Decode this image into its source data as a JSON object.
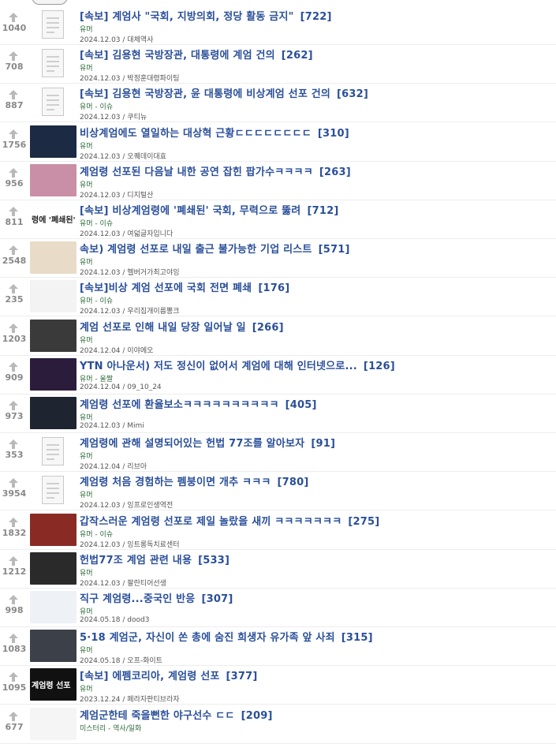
{
  "posts": [
    {
      "votes": "1040",
      "title": "[속보] 계엄사 \"국회, 지방의회, 정당 활동 금지\"",
      "comments": "[722]",
      "category": "유머",
      "meta": "2024.12.03 / 대체역사",
      "thumb": "doc",
      "thumb_color": "#ffffff"
    },
    {
      "votes": "708",
      "title": "[속보] 김용현 국방장관, 대통령에 계엄 건의",
      "comments": "[262]",
      "category": "유머",
      "meta": "2024.12.03 / 박정훈대령파이팅",
      "thumb": "doc",
      "thumb_color": "#ffffff"
    },
    {
      "votes": "887",
      "title": "[속보] 김용현 국방장관, 윤 대통령에 비상계엄 선포 건의",
      "comments": "[632]",
      "category": "유머 - 이슈",
      "meta": "2024.12.03 / 쿠티뉴",
      "thumb": "doc",
      "thumb_color": "#ffffff"
    },
    {
      "votes": "1756",
      "title": "비상계엄에도 열일하는 대상혁 근황ㄷㄷㄷㄷㄷㄷㄷㄷ",
      "comments": "[310]",
      "category": "유머",
      "meta": "2024.12.03 / 오퀘데이대효",
      "thumb": "img",
      "thumb_color": "#1d2a44"
    },
    {
      "votes": "956",
      "title": "계엄령 선포된 다음날 내한 공연 잡힌 팝가수ㅋㅋㅋㅋ",
      "comments": "[263]",
      "category": "유머",
      "meta": "2024.12.03 / 디지털산",
      "thumb": "img",
      "thumb_color": "#c98fa6"
    },
    {
      "votes": "811",
      "title": "[속보] 비상계엄령에 '폐쇄된' 국회, 무력으로 뚫려",
      "comments": "[712]",
      "category": "유머 - 이슈",
      "meta": "2024.12.03 / 여덟글자입니다",
      "thumb": "text",
      "thumb_color": "#ffffff",
      "thumb_text": "령에 '폐쇄된' 국회"
    },
    {
      "votes": "2548",
      "title": "속보) 계엄령 선포로 내일 출근 불가능한 기업 리스트",
      "comments": "[571]",
      "category": "유머",
      "meta": "2024.12.03 / 헬버거가최고야잉",
      "thumb": "img",
      "thumb_color": "#e8dcc8"
    },
    {
      "votes": "235",
      "title": "[속보]비상 계엄 선포에 국회 전면 폐쇄",
      "comments": "[176]",
      "category": "유머 - 이슈",
      "meta": "2024.12.03 / 우리집개이름뽕크",
      "thumb": "img",
      "thumb_color": "#f3f3f3"
    },
    {
      "votes": "1203",
      "title": "계엄 선포로 인해 내일 당장 일어날 일",
      "comments": "[266]",
      "category": "유머",
      "meta": "2024.12.04 / 이야에오",
      "thumb": "img",
      "thumb_color": "#3a3a3a"
    },
    {
      "votes": "909",
      "title": "YTN 아나운서) 저도 정신이 없어서 계엄에 대해 인터넷으로...",
      "comments": "[126]",
      "category": "유머 - 울짤",
      "meta": "2024.12.04 / 09_10_24",
      "thumb": "img",
      "thumb_color": "#2b1c3c"
    },
    {
      "votes": "973",
      "title": "계엄령 선포에 환율보소ㅋㅋㅋㅋㅋㅋㅋㅋㅋㅋ",
      "comments": "[405]",
      "category": "유머",
      "meta": "2024.12.03 / Mimi",
      "thumb": "img",
      "thumb_color": "#1e2430"
    },
    {
      "votes": "353",
      "title": "계엄령에 관해 설명되어있는 헌법 77조를 알아보자",
      "comments": "[91]",
      "category": "유머",
      "meta": "2024.12.04 / 리브아",
      "thumb": "doc",
      "thumb_color": "#ffffff"
    },
    {
      "votes": "3954",
      "title": "계엄령 처음 경험하는 펨붕이면 개추 ㅋㅋㅋ",
      "comments": "[780]",
      "category": "유머",
      "meta": "2024.12.03 / 잉프로인생역전",
      "thumb": "doc",
      "thumb_color": "#ffffff"
    },
    {
      "votes": "1832",
      "title": "갑작스러운 계엄령 선포로 제일 놀랐을 새끼 ㅋㅋㅋㅋㅋㅋㅋ",
      "comments": "[275]",
      "category": "유머 - 이슈",
      "meta": "2024.12.03 / 잉트롱독치료센터",
      "thumb": "img",
      "thumb_color": "#8a2a24"
    },
    {
      "votes": "1212",
      "title": "헌법77조 계엄 관련 내용",
      "comments": "[533]",
      "category": "유머",
      "meta": "2024.12.03 / 팔란티어선생",
      "thumb": "img",
      "thumb_color": "#2a2a2a"
    },
    {
      "votes": "998",
      "title": "직구 계엄령...중국인 반응",
      "comments": "[307]",
      "category": "유머",
      "meta": "2024.05.18 / dood3",
      "thumb": "img",
      "thumb_color": "#eef1f6"
    },
    {
      "votes": "1083",
      "title": "5·18 계엄군, 자신이 쏜 총에 숨진 희생자 유가족 앞 사죄",
      "comments": "[315]",
      "category": "유머",
      "meta": "2024.05.18 / 오프-화이트",
      "thumb": "img",
      "thumb_color": "#3c4048"
    },
    {
      "votes": "1095",
      "title": "[속보] 에펨코리아, 계엄령 선포",
      "comments": "[377]",
      "category": "유머",
      "meta": "2023.12.24 / 페라자판티브라자",
      "thumb": "text",
      "thumb_color": "#111111",
      "thumb_text": "계엄령 선포"
    },
    {
      "votes": "677",
      "title": "계엄군한테 죽을뻔한 야구선수 ㄷㄷ",
      "comments": "[209]",
      "category": "미스터리 - 역사/일화",
      "meta": "",
      "thumb": "img",
      "thumb_color": "#f5f5f5"
    }
  ]
}
